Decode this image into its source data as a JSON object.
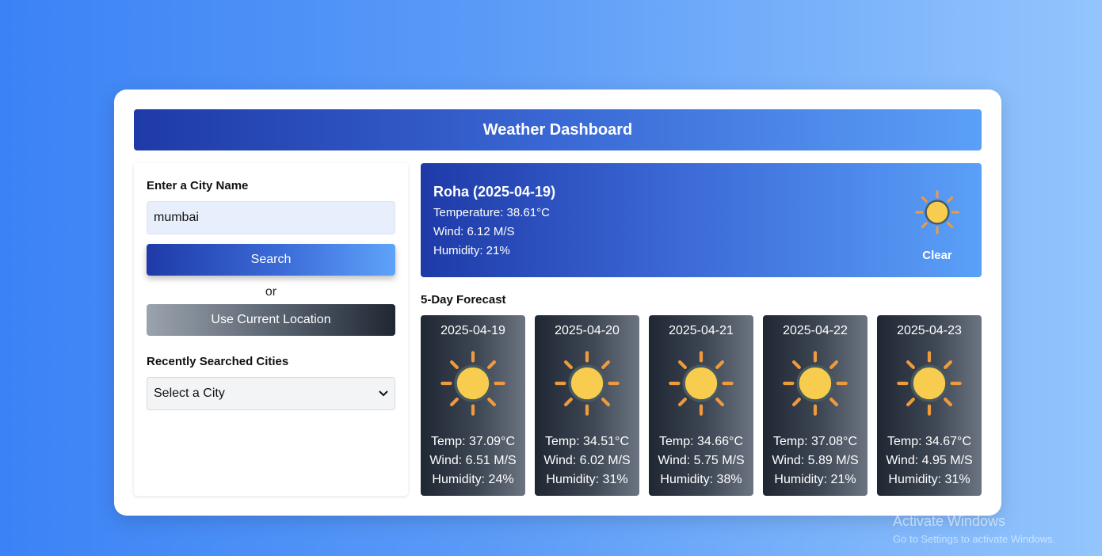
{
  "header": {
    "title": "Weather Dashboard"
  },
  "search": {
    "label": "Enter a City Name",
    "value": "mumbai",
    "button": "Search",
    "or": "or",
    "location_button": "Use Current Location"
  },
  "recent": {
    "label": "Recently Searched Cities",
    "selected": "Select a City"
  },
  "current": {
    "title": "Roha (2025-04-19)",
    "temperature": "Temperature: 38.61°C",
    "wind": "Wind: 6.12 M/S",
    "humidity": "Humidity: 21%",
    "description": "Clear",
    "icon": "sun-icon"
  },
  "forecast": {
    "title": "5-Day Forecast",
    "days": [
      {
        "date": "2025-04-19",
        "temp": "Temp: 37.09°C",
        "wind": "Wind: 6.51 M/S",
        "humidity": "Humidity: 24%",
        "icon": "sun-icon"
      },
      {
        "date": "2025-04-20",
        "temp": "Temp: 34.51°C",
        "wind": "Wind: 6.02 M/S",
        "humidity": "Humidity: 31%",
        "icon": "sun-icon"
      },
      {
        "date": "2025-04-21",
        "temp": "Temp: 34.66°C",
        "wind": "Wind: 5.75 M/S",
        "humidity": "Humidity: 38%",
        "icon": "sun-icon"
      },
      {
        "date": "2025-04-22",
        "temp": "Temp: 37.08°C",
        "wind": "Wind: 5.89 M/S",
        "humidity": "Humidity: 21%",
        "icon": "sun-icon"
      },
      {
        "date": "2025-04-23",
        "temp": "Temp: 34.67°C",
        "wind": "Wind: 4.95 M/S",
        "humidity": "Humidity: 31%",
        "icon": "sun-icon"
      }
    ]
  },
  "watermark": {
    "title": "Activate Windows",
    "subtitle": "Go to Settings to activate Windows."
  },
  "colors": {
    "accent_dark": "#1e3aa8",
    "accent_light": "#5ba0f8",
    "forecast_dark": "#1f2733",
    "sun_fill": "#f8cd4f",
    "sun_rays": "#f09a3e"
  }
}
